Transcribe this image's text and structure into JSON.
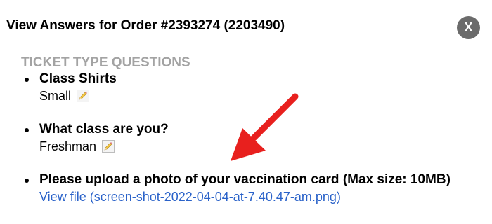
{
  "modal": {
    "title": "View Answers for Order #2393274 (2203490)",
    "close_label": "X"
  },
  "section": {
    "heading": "TICKET TYPE QUESTIONS"
  },
  "questions": [
    {
      "label": "Class Shirts",
      "answer": "Small"
    },
    {
      "label": "What class are you?",
      "answer": "Freshman"
    },
    {
      "label": "Please upload a photo of your vaccination card (Max size: 10MB)",
      "link": "View file (screen-shot-2022-04-04-at-7.40.47-am.png)"
    }
  ],
  "icons": {
    "edit": "pencil-edit-icon",
    "close": "close-icon",
    "annotation": "red-arrow"
  },
  "colors": {
    "link": "#2a62c9",
    "heading": "#a3a3a3",
    "arrow": "#e8201e",
    "close_bg": "#6b6b6b"
  }
}
